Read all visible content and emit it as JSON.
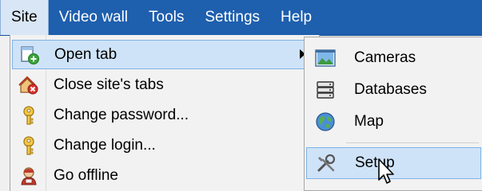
{
  "menubar": {
    "items": [
      "Site",
      "Video wall",
      "Tools",
      "Settings",
      "Help"
    ],
    "active_index": 0
  },
  "site_menu": {
    "items": [
      {
        "label": "Open tab",
        "icon": "open-tab-icon",
        "has_submenu": true
      },
      {
        "label": "Close site's tabs",
        "icon": "close-tabs-icon"
      },
      {
        "label": "Change password...",
        "icon": "key-icon"
      },
      {
        "label": "Change login...",
        "icon": "key-icon"
      },
      {
        "label": "Go offline",
        "icon": "user-offline-icon"
      }
    ]
  },
  "open_tab_submenu": {
    "items": [
      {
        "label": "Cameras",
        "icon": "cameras-icon"
      },
      {
        "label": "Databases",
        "icon": "databases-icon"
      },
      {
        "label": "Map",
        "icon": "globe-icon"
      },
      {
        "label": "Setup",
        "icon": "tools-icon"
      }
    ]
  },
  "colors": {
    "menubar_bg": "#1e5fae",
    "highlight_bg": "#cfe3f8",
    "highlight_border": "#7eb3e6"
  }
}
